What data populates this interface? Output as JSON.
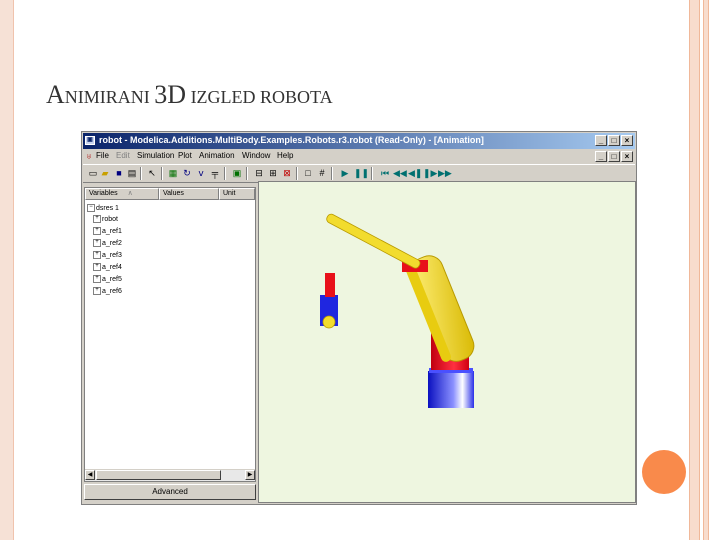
{
  "slide": {
    "title_initial": "A",
    "title_rest1": "NIMIRANI ",
    "title_3d": "3D",
    "title_rest2": " IZGLED ROBOTA"
  },
  "window": {
    "title": "robot - Modelica.Additions.MultiBody.Examples.Robots.r3.robot (Read-Only) - [Animation]",
    "app_icon": "dymola-icon",
    "caption_buttons": [
      "_",
      "□",
      "×"
    ]
  },
  "menu": {
    "items": [
      "File",
      "Edit",
      "Simulation",
      "Plot",
      "Animation",
      "Window",
      "Help"
    ]
  },
  "variables": {
    "columns": [
      "Variables",
      "Values",
      "Unit"
    ],
    "root": "dsres 1",
    "items": [
      "robot",
      "a_ref1",
      "a_ref2",
      "a_ref3",
      "a_ref4",
      "a_ref5",
      "a_ref6"
    ]
  },
  "advanced_button": "Advanced",
  "colors": {
    "robot_yellow": "#f2dc2e",
    "robot_red": "#e8101a",
    "robot_blue": "#1f26e0",
    "view_background": "#eef6e0"
  }
}
